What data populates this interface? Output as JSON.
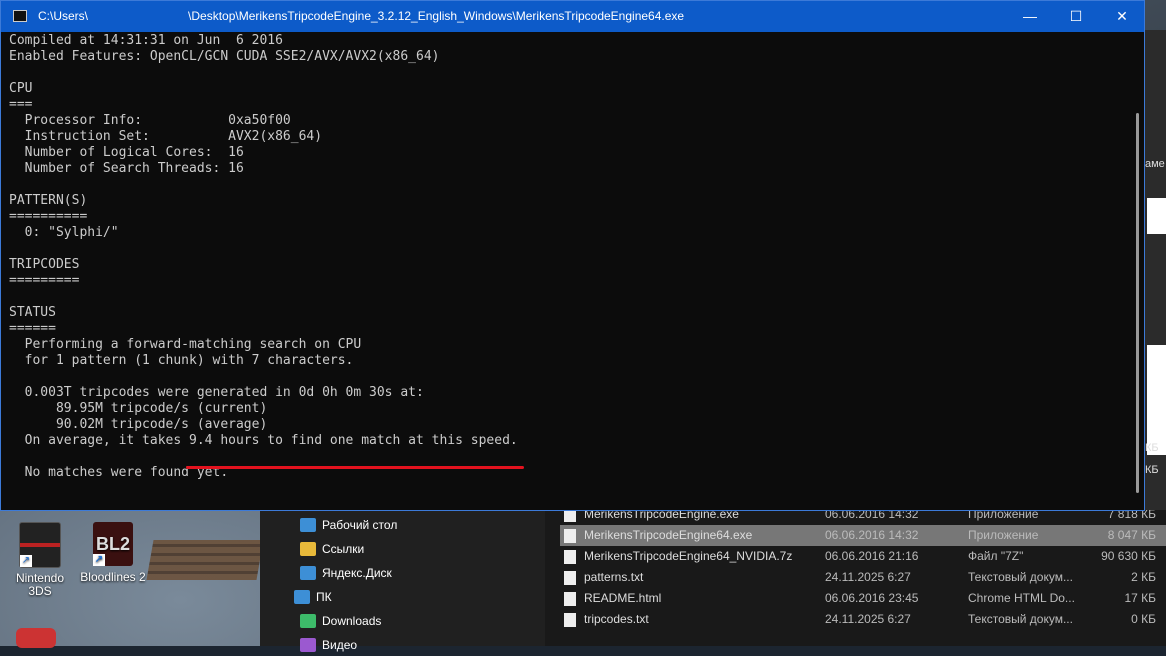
{
  "console": {
    "title": "C:\\Users\\                              \\Desktop\\MerikensTripcodeEngine_3.2.12_English_Windows\\MerikensTripcodeEngine64.exe",
    "lines": [
      "Compiled at 14:31:31 on Jun  6 2016",
      "Enabled Features: OpenCL/GCN CUDA SSE2/AVX/AVX2(x86_64)",
      "",
      "CPU",
      "===",
      "  Processor Info:           0xa50f00",
      "  Instruction Set:          AVX2(x86_64)",
      "  Number of Logical Cores:  16",
      "  Number of Search Threads: 16",
      "",
      "PATTERN(S)",
      "==========",
      "  0: \"Sylphi/\"",
      "",
      "TRIPCODES",
      "=========",
      "",
      "STATUS",
      "======",
      "  Performing a forward-matching search on CPU",
      "  for 1 pattern (1 chunk) with 7 characters.",
      "",
      "  0.003T tripcodes were generated in 0d 0h 0m 30s at:",
      "      89.95M tripcode/s (current)",
      "      90.02M tripcode/s (average)",
      "  On average, it takes 9.4 hours to find one match at this speed.",
      "",
      "  No matches were found yet."
    ]
  },
  "window_controls": {
    "minimize": "—",
    "maximize": "☐",
    "close": "✕"
  },
  "desktop": {
    "icons": [
      {
        "label": "Nintendo\n3DS"
      },
      {
        "label": "Bloodlines 2"
      }
    ],
    "bl2_text": "BL2"
  },
  "explorer": {
    "nav": [
      {
        "label": "Рабочий стол",
        "icon": "desktop-icon",
        "color": "#3d8fd6"
      },
      {
        "label": "Ссылки",
        "icon": "folder-icon",
        "color": "#e8b93a"
      },
      {
        "label": "Яндекс.Диск",
        "icon": "yandex-disk-icon",
        "color": "#3d8fd6"
      },
      {
        "label": "ПК",
        "icon": "pc-icon",
        "color": "#3d8fd6"
      },
      {
        "label": "Downloads",
        "icon": "download-icon",
        "color": "#3dbb6a"
      },
      {
        "label": "Видео",
        "icon": "video-icon",
        "color": "#9b59d0"
      }
    ],
    "files": [
      {
        "name": "MerikensTripcodeEngine.exe",
        "date": "06.06.2016 14:32",
        "type": "Приложение",
        "size": "7 818 КБ"
      },
      {
        "name": "MerikensTripcodeEngine64.exe",
        "date": "06.06.2016 14:32",
        "type": "Приложение",
        "size": "8 047 КБ"
      },
      {
        "name": "MerikensTripcodeEngine64_NVIDIA.7z",
        "date": "06.06.2016 21:16",
        "type": "Файл \"7Z\"",
        "size": "90 630 КБ"
      },
      {
        "name": "patterns.txt",
        "date": "24.11.2025 6:27",
        "type": "Текстовый докум...",
        "size": "2 КБ"
      },
      {
        "name": "README.html",
        "date": "06.06.2016 23:45",
        "type": "Chrome HTML Do...",
        "size": "17 КБ"
      },
      {
        "name": "tripcodes.txt",
        "date": "24.11.2025 6:27",
        "type": "Текстовый докум...",
        "size": "0 КБ"
      }
    ],
    "selected_index": 1
  },
  "right_strip": {
    "texts": [
      "аме",
      "КБ",
      "КБ"
    ]
  },
  "colors": {
    "titlebar": "#0d5bc9",
    "console_bg": "#0c0c0c",
    "console_text": "#cccccc",
    "underline": "#e4121e"
  }
}
